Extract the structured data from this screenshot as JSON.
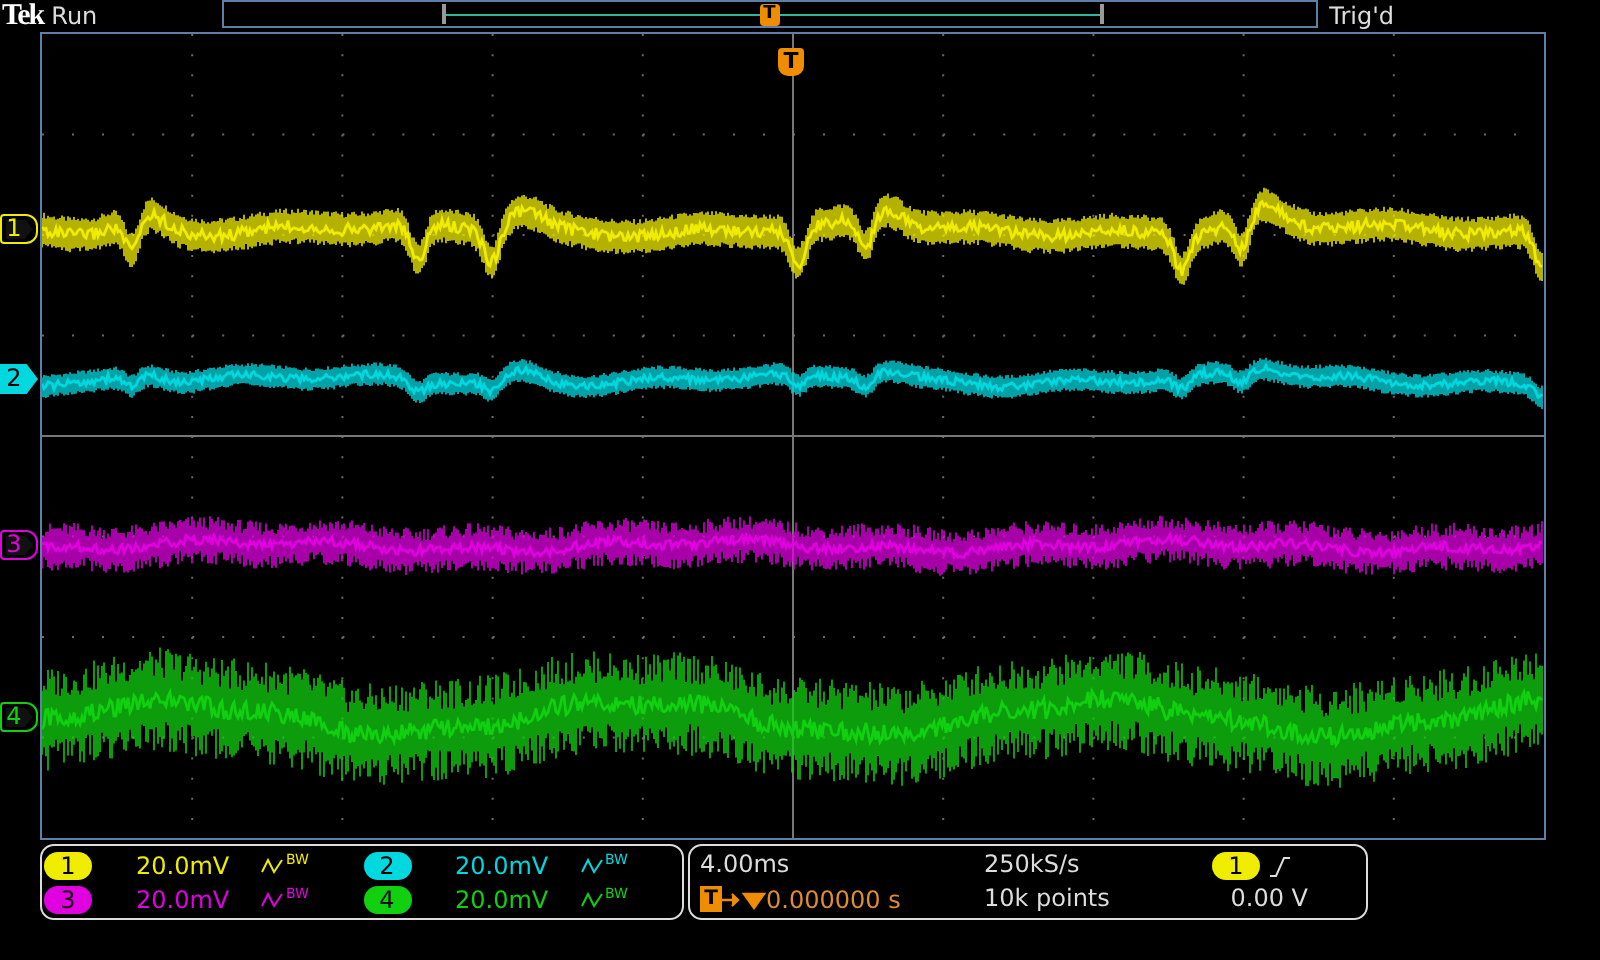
{
  "top_bar": {
    "logo": "Tek",
    "run_state": "Run",
    "trigger_status": "Trig'd",
    "trigger_marker": "T"
  },
  "trigger_marker": "T",
  "channels": [
    {
      "marker": "1",
      "label": "1",
      "color": "#f0ec00",
      "kind": "outline",
      "scale": "20.0mV",
      "bandwidth": "BW"
    },
    {
      "marker": "2",
      "label": "2",
      "color": "#00d8e0",
      "kind": "filled",
      "scale": "20.0mV",
      "bandwidth": "BW"
    },
    {
      "marker": "3",
      "label": "3",
      "color": "#e000e0",
      "kind": "outline",
      "scale": "20.0mV",
      "bandwidth": "BW"
    },
    {
      "marker": "4",
      "label": "4",
      "color": "#10d010",
      "kind": "outline",
      "scale": "20.0mV",
      "bandwidth": "BW"
    }
  ],
  "timebase": {
    "horizontal_scale": "4.00ms",
    "sample_rate": "250kS/s",
    "trigger_position_marker": "T",
    "trigger_delay": "0.000000 s",
    "record_length": "10k points"
  },
  "trigger": {
    "source": "1",
    "level": "0.00 V"
  }
}
